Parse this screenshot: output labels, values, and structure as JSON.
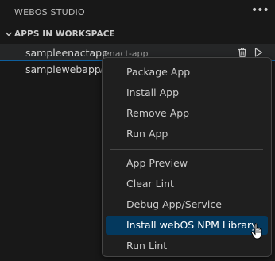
{
  "header": {
    "title": "WEBOS STUDIO",
    "more_icon": "more-horizontal-icon"
  },
  "section": {
    "title": "APPS IN WORKSPACE",
    "icon": "chevron-down-icon"
  },
  "apps": [
    {
      "name": "sampleenactapp",
      "description": "enact-app"
    },
    {
      "name": "samplewebapp",
      "description": "w"
    }
  ],
  "row_actions": [
    "trash-icon",
    "play-icon"
  ],
  "context_menu": {
    "group1": [
      "Package App",
      "Install App",
      "Remove App",
      "Run App"
    ],
    "group2": [
      "App Preview",
      "Clear Lint",
      "Debug App/Service",
      "Install webOS NPM Library",
      "Run Lint"
    ],
    "active_item": "Install webOS NPM Library"
  },
  "colors": {
    "accent": "#04395e",
    "focus_border": "#0e5f9e",
    "background": "#181818",
    "menu_background": "#1f1f1f"
  }
}
